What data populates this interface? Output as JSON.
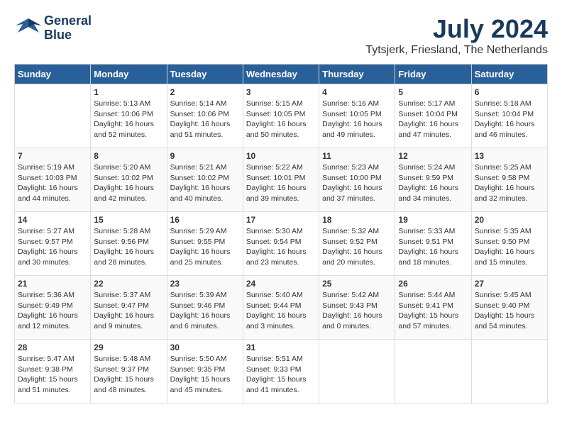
{
  "header": {
    "logo_line1": "General",
    "logo_line2": "Blue",
    "month_year": "July 2024",
    "location": "Tytsjerk, Friesland, The Netherlands"
  },
  "days_of_week": [
    "Sunday",
    "Monday",
    "Tuesday",
    "Wednesday",
    "Thursday",
    "Friday",
    "Saturday"
  ],
  "weeks": [
    [
      {
        "day": "",
        "info": ""
      },
      {
        "day": "1",
        "info": "Sunrise: 5:13 AM\nSunset: 10:06 PM\nDaylight: 16 hours\nand 52 minutes."
      },
      {
        "day": "2",
        "info": "Sunrise: 5:14 AM\nSunset: 10:06 PM\nDaylight: 16 hours\nand 51 minutes."
      },
      {
        "day": "3",
        "info": "Sunrise: 5:15 AM\nSunset: 10:05 PM\nDaylight: 16 hours\nand 50 minutes."
      },
      {
        "day": "4",
        "info": "Sunrise: 5:16 AM\nSunset: 10:05 PM\nDaylight: 16 hours\nand 49 minutes."
      },
      {
        "day": "5",
        "info": "Sunrise: 5:17 AM\nSunset: 10:04 PM\nDaylight: 16 hours\nand 47 minutes."
      },
      {
        "day": "6",
        "info": "Sunrise: 5:18 AM\nSunset: 10:04 PM\nDaylight: 16 hours\nand 46 minutes."
      }
    ],
    [
      {
        "day": "7",
        "info": "Sunrise: 5:19 AM\nSunset: 10:03 PM\nDaylight: 16 hours\nand 44 minutes."
      },
      {
        "day": "8",
        "info": "Sunrise: 5:20 AM\nSunset: 10:02 PM\nDaylight: 16 hours\nand 42 minutes."
      },
      {
        "day": "9",
        "info": "Sunrise: 5:21 AM\nSunset: 10:02 PM\nDaylight: 16 hours\nand 40 minutes."
      },
      {
        "day": "10",
        "info": "Sunrise: 5:22 AM\nSunset: 10:01 PM\nDaylight: 16 hours\nand 39 minutes."
      },
      {
        "day": "11",
        "info": "Sunrise: 5:23 AM\nSunset: 10:00 PM\nDaylight: 16 hours\nand 37 minutes."
      },
      {
        "day": "12",
        "info": "Sunrise: 5:24 AM\nSunset: 9:59 PM\nDaylight: 16 hours\nand 34 minutes."
      },
      {
        "day": "13",
        "info": "Sunrise: 5:25 AM\nSunset: 9:58 PM\nDaylight: 16 hours\nand 32 minutes."
      }
    ],
    [
      {
        "day": "14",
        "info": "Sunrise: 5:27 AM\nSunset: 9:57 PM\nDaylight: 16 hours\nand 30 minutes."
      },
      {
        "day": "15",
        "info": "Sunrise: 5:28 AM\nSunset: 9:56 PM\nDaylight: 16 hours\nand 28 minutes."
      },
      {
        "day": "16",
        "info": "Sunrise: 5:29 AM\nSunset: 9:55 PM\nDaylight: 16 hours\nand 25 minutes."
      },
      {
        "day": "17",
        "info": "Sunrise: 5:30 AM\nSunset: 9:54 PM\nDaylight: 16 hours\nand 23 minutes."
      },
      {
        "day": "18",
        "info": "Sunrise: 5:32 AM\nSunset: 9:52 PM\nDaylight: 16 hours\nand 20 minutes."
      },
      {
        "day": "19",
        "info": "Sunrise: 5:33 AM\nSunset: 9:51 PM\nDaylight: 16 hours\nand 18 minutes."
      },
      {
        "day": "20",
        "info": "Sunrise: 5:35 AM\nSunset: 9:50 PM\nDaylight: 16 hours\nand 15 minutes."
      }
    ],
    [
      {
        "day": "21",
        "info": "Sunrise: 5:36 AM\nSunset: 9:49 PM\nDaylight: 16 hours\nand 12 minutes."
      },
      {
        "day": "22",
        "info": "Sunrise: 5:37 AM\nSunset: 9:47 PM\nDaylight: 16 hours\nand 9 minutes."
      },
      {
        "day": "23",
        "info": "Sunrise: 5:39 AM\nSunset: 9:46 PM\nDaylight: 16 hours\nand 6 minutes."
      },
      {
        "day": "24",
        "info": "Sunrise: 5:40 AM\nSunset: 9:44 PM\nDaylight: 16 hours\nand 3 minutes."
      },
      {
        "day": "25",
        "info": "Sunrise: 5:42 AM\nSunset: 9:43 PM\nDaylight: 16 hours\nand 0 minutes."
      },
      {
        "day": "26",
        "info": "Sunrise: 5:44 AM\nSunset: 9:41 PM\nDaylight: 15 hours\nand 57 minutes."
      },
      {
        "day": "27",
        "info": "Sunrise: 5:45 AM\nSunset: 9:40 PM\nDaylight: 15 hours\nand 54 minutes."
      }
    ],
    [
      {
        "day": "28",
        "info": "Sunrise: 5:47 AM\nSunset: 9:38 PM\nDaylight: 15 hours\nand 51 minutes."
      },
      {
        "day": "29",
        "info": "Sunrise: 5:48 AM\nSunset: 9:37 PM\nDaylight: 15 hours\nand 48 minutes."
      },
      {
        "day": "30",
        "info": "Sunrise: 5:50 AM\nSunset: 9:35 PM\nDaylight: 15 hours\nand 45 minutes."
      },
      {
        "day": "31",
        "info": "Sunrise: 5:51 AM\nSunset: 9:33 PM\nDaylight: 15 hours\nand 41 minutes."
      },
      {
        "day": "",
        "info": ""
      },
      {
        "day": "",
        "info": ""
      },
      {
        "day": "",
        "info": ""
      }
    ]
  ]
}
